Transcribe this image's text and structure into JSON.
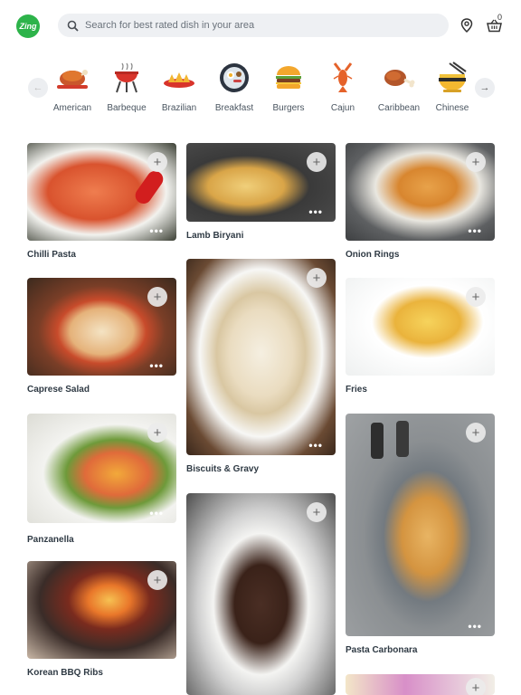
{
  "header": {
    "logo_text": "Zing",
    "search_placeholder": "Search for best rated dish in your area",
    "cart_count": "0"
  },
  "categories": [
    "American",
    "Barbeque",
    "Brazilian",
    "Breakfast",
    "Burgers",
    "Cajun",
    "Caribbean",
    "Chinese"
  ],
  "dishes": {
    "chilli_pasta": "Chilli Pasta",
    "lamb_biryani": "Lamb Biryani",
    "onion_rings": "Onion Rings",
    "caprese_salad": "Caprese Salad",
    "biscuits_gravy": "Biscuits & Gravy",
    "fries": "Fries",
    "panzanella": "Panzanella",
    "pasta_carbonara": "Pasta Carbonara",
    "korean_bbq_ribs": "Korean BBQ Ribs"
  },
  "actions": {
    "add_symbol": "+",
    "more_symbol": "•••"
  }
}
